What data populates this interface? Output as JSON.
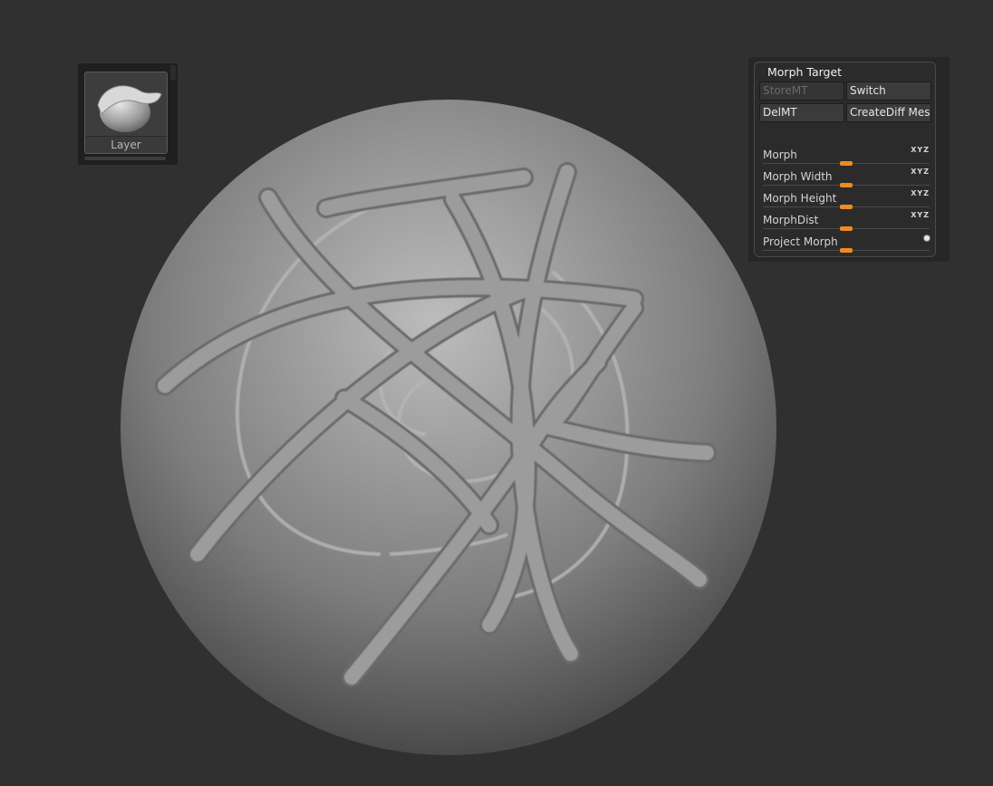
{
  "brush": {
    "label": "Layer",
    "icon": "layer-brush-icon"
  },
  "morph_target": {
    "title": "Morph Target",
    "buttons": {
      "store": "StoreMT",
      "switch": "Switch",
      "delete": "DelMT",
      "create_diff": "CreateDiff Mesh"
    },
    "sliders": [
      {
        "label": "Morph",
        "axis_label": "XYZ",
        "value_fraction": 0.5
      },
      {
        "label": "Morph Width",
        "axis_label": "XYZ",
        "value_fraction": 0.5
      },
      {
        "label": "Morph Height",
        "axis_label": "XYZ",
        "value_fraction": 0.5
      },
      {
        "label": "MorphDist",
        "axis_label": "XYZ",
        "value_fraction": 0.5
      },
      {
        "label": "Project Morph",
        "value_fraction": 0.5
      }
    ],
    "accent_color": "#f08c1e"
  },
  "colors": {
    "background": "#303030",
    "sculpt_material": "#8c8c8c"
  }
}
